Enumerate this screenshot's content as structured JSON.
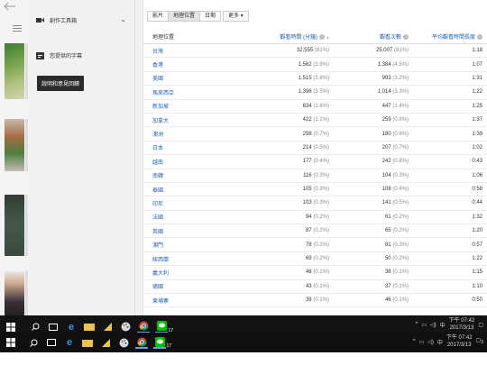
{
  "sidebar": {
    "item1_label": "創作工具箱",
    "item2_label": "您提供的字幕",
    "tooltip": "說明和意見回饋"
  },
  "tabs": [
    "影片",
    "地理位置",
    "日期",
    "更多"
  ],
  "table": {
    "headers": {
      "location": "地理位置",
      "watch_time": "觀看時間 (分鐘)",
      "views": "觀看次數",
      "avg_duration": "平均觀看時間長度"
    },
    "rows": [
      {
        "name": "台灣",
        "watch": "32,555",
        "watch_pct": "(81%)",
        "views": "25,007",
        "views_pct": "(81%)",
        "avg": "1:18"
      },
      {
        "name": "香港",
        "watch": "1,562",
        "watch_pct": "(3.9%)",
        "views": "1,384",
        "views_pct": "(4.5%)",
        "avg": "1:07"
      },
      {
        "name": "美國",
        "watch": "1,515",
        "watch_pct": "(3.8%)",
        "views": "993",
        "views_pct": "(3.2%)",
        "avg": "1:31"
      },
      {
        "name": "馬來西亞",
        "watch": "1,396",
        "watch_pct": "(3.5%)",
        "views": "1,014",
        "views_pct": "(3.3%)",
        "avg": "1:22"
      },
      {
        "name": "新加坡",
        "watch": "634",
        "watch_pct": "(1.6%)",
        "views": "447",
        "views_pct": "(1.4%)",
        "avg": "1:25"
      },
      {
        "name": "加拿大",
        "watch": "422",
        "watch_pct": "(1.1%)",
        "views": "259",
        "views_pct": "(0.8%)",
        "avg": "1:37"
      },
      {
        "name": "澳洲",
        "watch": "298",
        "watch_pct": "(0.7%)",
        "views": "180",
        "views_pct": "(0.6%)",
        "avg": "1:39"
      },
      {
        "name": "日本",
        "watch": "214",
        "watch_pct": "(0.5%)",
        "views": "207",
        "views_pct": "(0.7%)",
        "avg": "1:02"
      },
      {
        "name": "越南",
        "watch": "177",
        "watch_pct": "(0.4%)",
        "views": "242",
        "views_pct": "(0.8%)",
        "avg": "0:43"
      },
      {
        "name": "南韓",
        "watch": "116",
        "watch_pct": "(0.3%)",
        "views": "104",
        "views_pct": "(0.3%)",
        "avg": "1:06"
      },
      {
        "name": "泰國",
        "watch": "105",
        "watch_pct": "(0.3%)",
        "views": "108",
        "views_pct": "(0.4%)",
        "avg": "0:58"
      },
      {
        "name": "印尼",
        "watch": "103",
        "watch_pct": "(0.3%)",
        "views": "141",
        "views_pct": "(0.5%)",
        "avg": "0:44"
      },
      {
        "name": "法國",
        "watch": "94",
        "watch_pct": "(0.2%)",
        "views": "61",
        "views_pct": "(0.2%)",
        "avg": "1:32"
      },
      {
        "name": "英國",
        "watch": "87",
        "watch_pct": "(0.2%)",
        "views": "65",
        "views_pct": "(0.2%)",
        "avg": "1:20"
      },
      {
        "name": "澳門",
        "watch": "78",
        "watch_pct": "(0.2%)",
        "views": "81",
        "views_pct": "(0.3%)",
        "avg": "0:57"
      },
      {
        "name": "紐西蘭",
        "watch": "69",
        "watch_pct": "(0.2%)",
        "views": "50",
        "views_pct": "(0.2%)",
        "avg": "1:22"
      },
      {
        "name": "義大利",
        "watch": "48",
        "watch_pct": "(0.1%)",
        "views": "38",
        "views_pct": "(0.1%)",
        "avg": "1:15"
      },
      {
        "name": "德國",
        "watch": "43",
        "watch_pct": "(0.1%)",
        "views": "37",
        "views_pct": "(0.1%)",
        "avg": "1:10"
      },
      {
        "name": "柬埔寨",
        "watch": "39",
        "watch_pct": "(0.1%)",
        "views": "46",
        "views_pct": "(0.1%)",
        "avg": "0:50"
      }
    ]
  },
  "taskbar1": {
    "time": "下午 07:42",
    "date": "2017/3/13",
    "badge": "17"
  },
  "taskbar2": {
    "time": "下午 07:42",
    "date": "2017/3/13",
    "badge": "17",
    "notify": "3"
  }
}
